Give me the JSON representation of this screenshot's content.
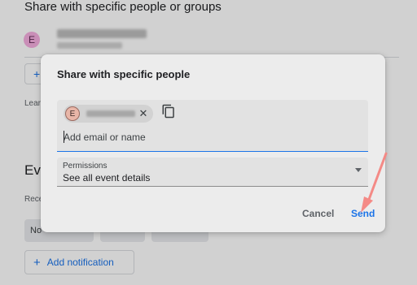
{
  "background": {
    "title": "Share with specific people or groups",
    "avatar_letter": "E",
    "add_icon": "plus-icon",
    "learn_text": "Lear",
    "section_heading": "Eve",
    "rece_text": "Rece",
    "chip_text": "No",
    "add_notification_label": "Add notification"
  },
  "dialog": {
    "title": "Share with specific people",
    "recipient_chip": {
      "avatar_letter": "E",
      "close_icon": "close-icon"
    },
    "copy_icon": "copy-icon",
    "email_placeholder": "Add email or name",
    "permissions": {
      "label": "Permissions",
      "value": "See all event details"
    },
    "cancel_label": "Cancel",
    "send_label": "Send"
  },
  "colors": {
    "accent": "#1a73e8",
    "annotation_arrow": "#f48a86",
    "avatar_bg": "#f6aee0"
  }
}
